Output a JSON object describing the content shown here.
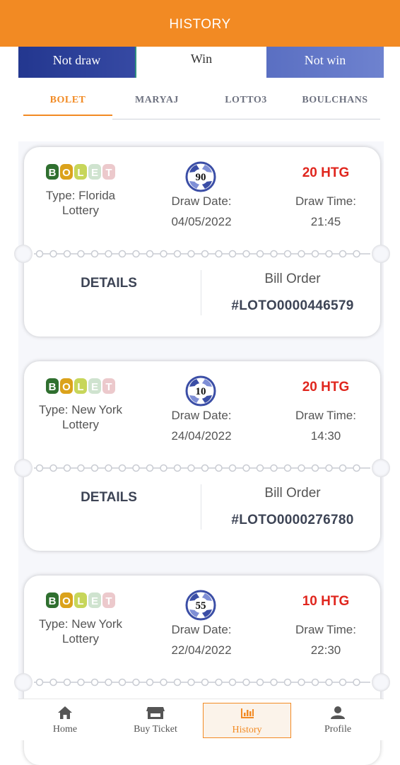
{
  "header": {
    "title": "HISTORY"
  },
  "filters": [
    {
      "label": "Not draw"
    },
    {
      "label": "Win"
    },
    {
      "label": "Not win"
    }
  ],
  "tabs": [
    {
      "label": "BOLET",
      "active": true
    },
    {
      "label": "MARYAJ",
      "active": false
    },
    {
      "label": "LOTTO3",
      "active": false
    },
    {
      "label": "BOULCHANS",
      "active": false
    }
  ],
  "logo_letters": [
    "B",
    "O",
    "L",
    "E",
    "T"
  ],
  "logo_colors": [
    "#2f6f2f",
    "#dba21b",
    "#c7d65a",
    "#cfe3cf",
    "#ecc9cc"
  ],
  "tickets": [
    {
      "number": "90",
      "type_label": "Type: Florida",
      "type_label2": "Lottery",
      "amount": "20 HTG",
      "draw_date_label": "Draw Date:",
      "draw_date": "04/05/2022",
      "draw_time_label": "Draw Time:",
      "draw_time": "21:45",
      "details_label": "DETAILS",
      "bill_label": "Bill Order",
      "bill_order": "#LOTO0000446579"
    },
    {
      "number": "10",
      "type_label": "Type: New York",
      "type_label2": "Lottery",
      "amount": "20 HTG",
      "draw_date_label": "Draw Date:",
      "draw_date": "24/04/2022",
      "draw_time_label": "Draw Time:",
      "draw_time": "14:30",
      "details_label": "DETAILS",
      "bill_label": "Bill Order",
      "bill_order": "#LOTO0000276780"
    },
    {
      "number": "55",
      "type_label": "Type: New York",
      "type_label2": "Lottery",
      "amount": "10 HTG",
      "draw_date_label": "Draw Date:",
      "draw_date": "22/04/2022",
      "draw_time_label": "Draw Time:",
      "draw_time": "22:30"
    }
  ],
  "nav": [
    {
      "label": "Home",
      "icon": "home-icon"
    },
    {
      "label": "Buy Ticket",
      "icon": "store-icon"
    },
    {
      "label": "History",
      "icon": "chart-icon",
      "active": true
    },
    {
      "label": "Profile",
      "icon": "person-icon"
    }
  ],
  "colors": {
    "brand_orange": "#f28a23",
    "amount_red": "#e0261e",
    "not_draw_blue": "#23378f",
    "not_win_blue": "#5a6fc2"
  }
}
